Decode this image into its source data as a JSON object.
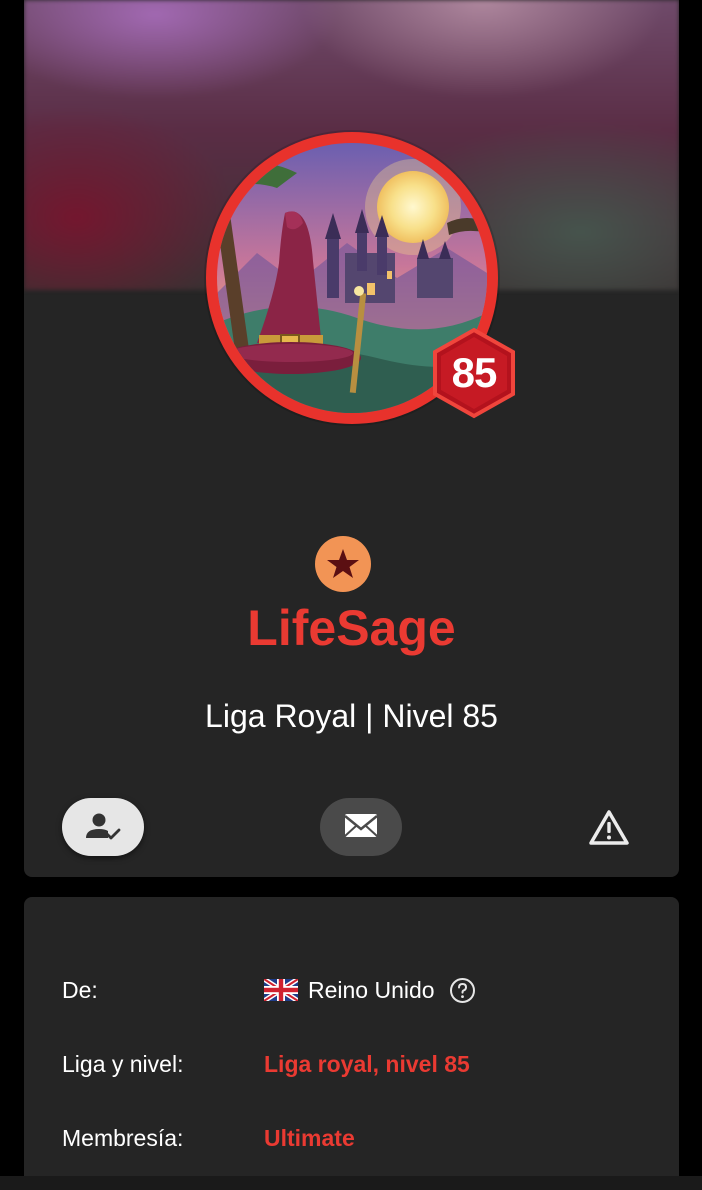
{
  "profile": {
    "username": "LifeSage",
    "level_badge": "85",
    "league_line": "Liga Royal | Nivel 85",
    "rank_icon": "star-icon",
    "colors": {
      "username": "#ea3a32",
      "avatar_ring": "#e8322c",
      "rank_badge": "#f29455"
    }
  },
  "actions": {
    "friend_icon": "person-check-icon",
    "message_icon": "envelope-icon",
    "report_icon": "warning-triangle-icon"
  },
  "info": {
    "from_label": "De:",
    "from_value": "Reino Unido",
    "from_flag": "uk-flag-icon",
    "league_label": "Liga y nivel:",
    "league_value": "Liga royal, nivel 85",
    "membership_label": "Membresía:",
    "membership_value": "Ultimate"
  }
}
